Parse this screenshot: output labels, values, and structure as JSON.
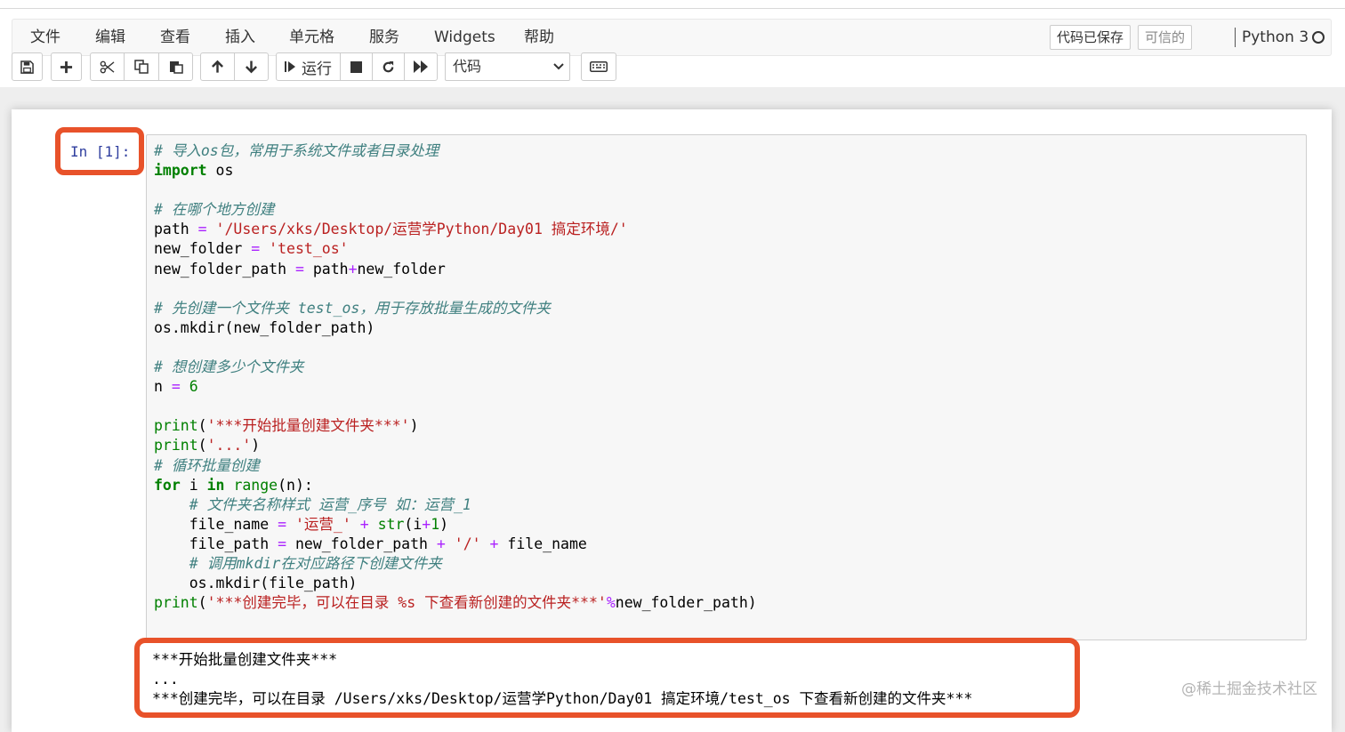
{
  "menu": {
    "items": [
      "文件",
      "编辑",
      "查看",
      "插入",
      "单元格",
      "服务",
      "Widgets",
      "帮助"
    ],
    "saved_status": "代码已保存",
    "trusted": "可信的",
    "kernel": "Python 3"
  },
  "toolbar": {
    "run_label": "运行",
    "cell_type": "代码",
    "icons": [
      "save-icon",
      "plus-icon",
      "cut-icon",
      "copy-icon",
      "paste-icon",
      "arrow-up-icon",
      "arrow-down-icon",
      "run-icon",
      "stop-icon",
      "restart-icon",
      "fast-forward-icon",
      "keyboard-icon"
    ]
  },
  "cell": {
    "prompt": "In [1]:",
    "code_lines": [
      [
        {
          "t": "cm",
          "v": "# 导入os包，常用于系统文件或者目录处理"
        }
      ],
      [
        {
          "t": "kw",
          "v": "import"
        },
        {
          "t": "",
          "v": " os"
        }
      ],
      [],
      [
        {
          "t": "cm",
          "v": "# 在哪个地方创建"
        }
      ],
      [
        {
          "t": "",
          "v": "path "
        },
        {
          "t": "op",
          "v": "="
        },
        {
          "t": "",
          "v": " "
        },
        {
          "t": "st",
          "v": "'/Users/xks/Desktop/运营学Python/Day01 搞定环境/'"
        }
      ],
      [
        {
          "t": "",
          "v": "new_folder "
        },
        {
          "t": "op",
          "v": "="
        },
        {
          "t": "",
          "v": " "
        },
        {
          "t": "st",
          "v": "'test_os'"
        }
      ],
      [
        {
          "t": "",
          "v": "new_folder_path "
        },
        {
          "t": "op",
          "v": "="
        },
        {
          "t": "",
          "v": " path"
        },
        {
          "t": "op",
          "v": "+"
        },
        {
          "t": "",
          "v": "new_folder"
        }
      ],
      [],
      [
        {
          "t": "cm",
          "v": "# 先创建一个文件夹 test_os，用于存放批量生成的文件夹"
        }
      ],
      [
        {
          "t": "",
          "v": "os.mkdir(new_folder_path)"
        }
      ],
      [],
      [
        {
          "t": "cm",
          "v": "# 想创建多少个文件夹"
        }
      ],
      [
        {
          "t": "",
          "v": "n "
        },
        {
          "t": "op",
          "v": "="
        },
        {
          "t": "",
          "v": " "
        },
        {
          "t": "nu",
          "v": "6"
        }
      ],
      [],
      [
        {
          "t": "bi",
          "v": "print"
        },
        {
          "t": "",
          "v": "("
        },
        {
          "t": "st",
          "v": "'***开始批量创建文件夹***'"
        },
        {
          "t": "",
          "v": ")"
        }
      ],
      [
        {
          "t": "bi",
          "v": "print"
        },
        {
          "t": "",
          "v": "("
        },
        {
          "t": "st",
          "v": "'...'"
        },
        {
          "t": "",
          "v": ")"
        }
      ],
      [
        {
          "t": "cm",
          "v": "# 循环批量创建"
        }
      ],
      [
        {
          "t": "kw",
          "v": "for"
        },
        {
          "t": "",
          "v": " i "
        },
        {
          "t": "kw",
          "v": "in"
        },
        {
          "t": "",
          "v": " "
        },
        {
          "t": "bi",
          "v": "range"
        },
        {
          "t": "",
          "v": "(n):"
        }
      ],
      [
        {
          "t": "",
          "v": "    "
        },
        {
          "t": "cm",
          "v": "# 文件夹名称样式 运营_序号 如：运营_1"
        }
      ],
      [
        {
          "t": "",
          "v": "    file_name "
        },
        {
          "t": "op",
          "v": "="
        },
        {
          "t": "",
          "v": " "
        },
        {
          "t": "st",
          "v": "'运营_'"
        },
        {
          "t": "",
          "v": " "
        },
        {
          "t": "op",
          "v": "+"
        },
        {
          "t": "",
          "v": " "
        },
        {
          "t": "bi",
          "v": "str"
        },
        {
          "t": "",
          "v": "(i"
        },
        {
          "t": "op",
          "v": "+"
        },
        {
          "t": "nu",
          "v": "1"
        },
        {
          "t": "",
          "v": ")"
        }
      ],
      [
        {
          "t": "",
          "v": "    file_path "
        },
        {
          "t": "op",
          "v": "="
        },
        {
          "t": "",
          "v": " new_folder_path "
        },
        {
          "t": "op",
          "v": "+"
        },
        {
          "t": "",
          "v": " "
        },
        {
          "t": "st",
          "v": "'/'"
        },
        {
          "t": "",
          "v": " "
        },
        {
          "t": "op",
          "v": "+"
        },
        {
          "t": "",
          "v": " file_name"
        }
      ],
      [
        {
          "t": "",
          "v": "    "
        },
        {
          "t": "cm",
          "v": "# 调用mkdir在对应路径下创建文件夹"
        }
      ],
      [
        {
          "t": "",
          "v": "    os.mkdir(file_path)"
        }
      ],
      [
        {
          "t": "bi",
          "v": "print"
        },
        {
          "t": "",
          "v": "("
        },
        {
          "t": "st",
          "v": "'***创建完毕，可以在目录 %s 下查看新创建的文件夹***'"
        },
        {
          "t": "op",
          "v": "%"
        },
        {
          "t": "",
          "v": "new_folder_path)"
        }
      ]
    ],
    "output_lines": [
      "***开始批量创建文件夹***",
      "...",
      "***创建完毕，可以在目录 /Users/xks/Desktop/运营学Python/Day01 搞定环境/test_os 下查看新创建的文件夹***"
    ]
  },
  "watermark": "@稀土掘金技术社区"
}
